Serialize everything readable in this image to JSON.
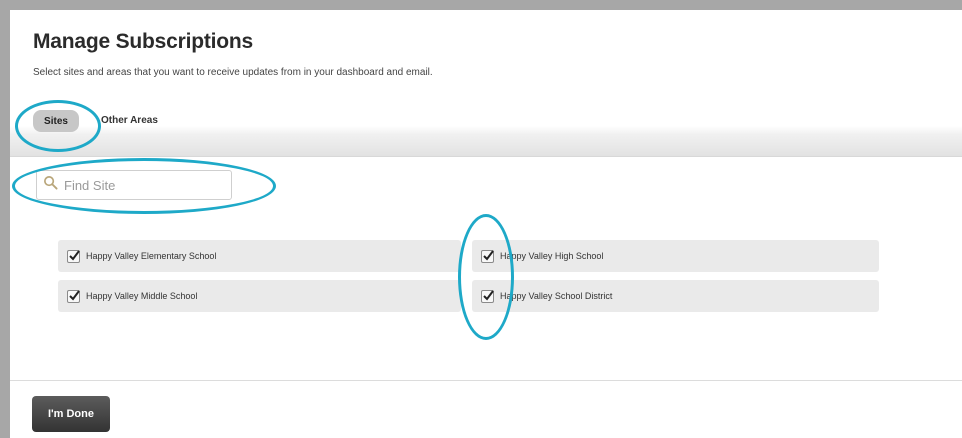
{
  "page": {
    "title": "Manage Subscriptions",
    "subtitle": "Select sites and areas that you want to receive updates from in your dashboard and email."
  },
  "tabs": [
    {
      "label": "Sites",
      "active": true
    },
    {
      "label": "Other Areas",
      "active": false
    }
  ],
  "search": {
    "placeholder": "Find Site",
    "value": "",
    "icon": "search-icon"
  },
  "sites": [
    {
      "label": "Happy Valley Elementary School",
      "checked": true
    },
    {
      "label": "Happy Valley High School",
      "checked": true
    },
    {
      "label": "Happy Valley Middle School",
      "checked": true
    },
    {
      "label": "Happy Valley School District",
      "checked": true
    }
  ],
  "footer": {
    "done_label": "I'm Done"
  },
  "colors": {
    "annotation": "#1ea9c8",
    "active_tab": "#c7c7c7",
    "done_button": "#3a3a3a"
  }
}
